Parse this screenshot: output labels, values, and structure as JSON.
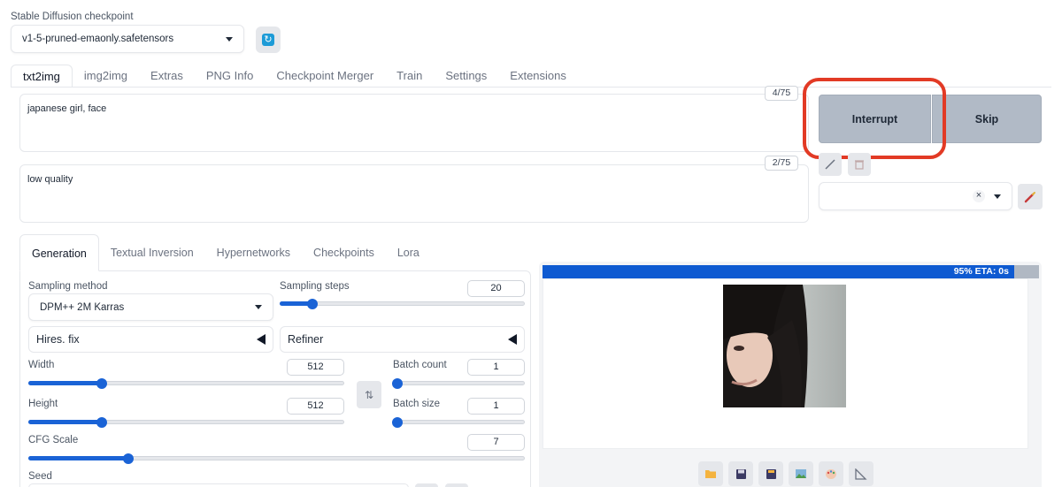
{
  "checkpoint": {
    "label": "Stable Diffusion checkpoint",
    "value": "v1-5-pruned-emaonly.safetensors",
    "refresh_icon": "refresh-icon"
  },
  "main_tabs": [
    {
      "label": "txt2img",
      "active": true
    },
    {
      "label": "img2img"
    },
    {
      "label": "Extras"
    },
    {
      "label": "PNG Info"
    },
    {
      "label": "Checkpoint Merger"
    },
    {
      "label": "Train"
    },
    {
      "label": "Settings"
    },
    {
      "label": "Extensions"
    }
  ],
  "prompt": {
    "value": "japanese girl, face",
    "counter": "4/75"
  },
  "negative_prompt": {
    "value": "low quality",
    "counter": "2/75"
  },
  "actions": {
    "interrupt": "Interrupt",
    "skip": "Skip"
  },
  "style_tools": {
    "edit_icon": "pencil-icon",
    "trash_icon": "trash-icon",
    "clear_glyph": "×"
  },
  "sub_tabs": [
    {
      "label": "Generation",
      "active": true
    },
    {
      "label": "Textual Inversion"
    },
    {
      "label": "Hypernetworks"
    },
    {
      "label": "Checkpoints"
    },
    {
      "label": "Lora"
    }
  ],
  "generation": {
    "sampling_method": {
      "label": "Sampling method",
      "value": "DPM++ 2M Karras"
    },
    "sampling_steps": {
      "label": "Sampling steps",
      "value": "20",
      "fraction": 0.13
    },
    "hires_fix": "Hires. fix",
    "refiner": "Refiner",
    "width": {
      "label": "Width",
      "value": "512",
      "fraction": 0.23
    },
    "height": {
      "label": "Height",
      "value": "512",
      "fraction": 0.23
    },
    "batch_count": {
      "label": "Batch count",
      "value": "1",
      "fraction": 0.0
    },
    "batch_size": {
      "label": "Batch size",
      "value": "1",
      "fraction": 0.0
    },
    "cfg_scale": {
      "label": "CFG Scale",
      "value": "7",
      "fraction": 0.2
    },
    "seed": {
      "label": "Seed"
    },
    "swap_glyph": "⇅"
  },
  "output": {
    "progress_text": "95% ETA: 0s",
    "progress": 0.95,
    "toolbar_icons": [
      "folder-icon",
      "save-icon",
      "zip-icon",
      "image-icon",
      "palette-icon",
      "ruler-icon"
    ]
  },
  "colors": {
    "accent": "#1a63d6",
    "highlight": "#e23a25",
    "button": "#b1bac6"
  }
}
